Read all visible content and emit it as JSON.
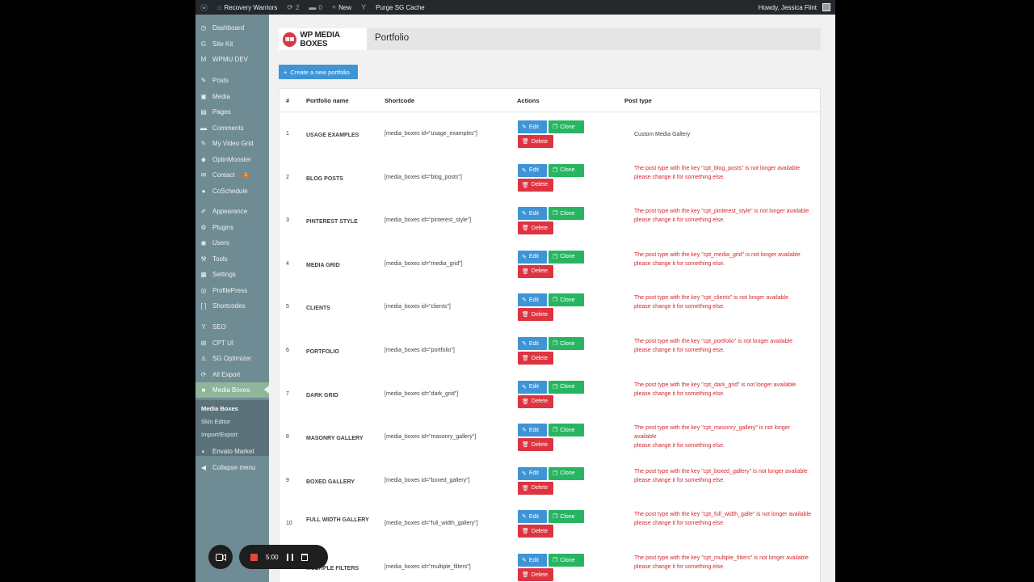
{
  "admin_bar": {
    "site_name": "Recovery Warriors",
    "updates_count": "2",
    "comments_count": "0",
    "new_label": "New",
    "purge_label": "Purge SG Cache",
    "howdy": "Howdy, Jessica Flint"
  },
  "sidebar": {
    "items": [
      {
        "label": "Dashboard",
        "icon": "dashboard-icon",
        "glyph": "◷"
      },
      {
        "label": "Site Kit",
        "icon": "sitekit-icon",
        "glyph": "G"
      },
      {
        "label": "WPMU DEV",
        "icon": "wpmudev-icon",
        "glyph": "M"
      },
      {
        "label": "Posts",
        "icon": "pin-icon",
        "glyph": "✎"
      },
      {
        "label": "Media",
        "icon": "media-icon",
        "glyph": "▣"
      },
      {
        "label": "Pages",
        "icon": "pages-icon",
        "glyph": "▤"
      },
      {
        "label": "Comments",
        "icon": "comments-icon",
        "glyph": "▬"
      },
      {
        "label": "My Video Grid",
        "icon": "pin-icon",
        "glyph": "✎"
      },
      {
        "label": "OptinMonster",
        "icon": "optinmonster-icon",
        "glyph": "☻"
      },
      {
        "label": "Contact",
        "icon": "mail-icon",
        "glyph": "✉",
        "badge": "1"
      },
      {
        "label": "CoSchedule",
        "icon": "coschedule-icon",
        "glyph": "●"
      },
      {
        "label": "Appearance",
        "icon": "brush-icon",
        "glyph": "✐"
      },
      {
        "label": "Plugins",
        "icon": "plugin-icon",
        "glyph": "⚙"
      },
      {
        "label": "Users",
        "icon": "users-icon",
        "glyph": "◉"
      },
      {
        "label": "Tools",
        "icon": "wrench-icon",
        "glyph": "⚒"
      },
      {
        "label": "Settings",
        "icon": "settings-icon",
        "glyph": "▦"
      },
      {
        "label": "ProfilePress",
        "icon": "profilepress-icon",
        "glyph": "◎"
      },
      {
        "label": "Shortcodes",
        "icon": "shortcodes-icon",
        "glyph": "[ ]"
      },
      {
        "label": "SEO",
        "icon": "yoast-icon",
        "glyph": "Y"
      },
      {
        "label": "CPT UI",
        "icon": "cptui-icon",
        "glyph": "⊞"
      },
      {
        "label": "SG Optimizer",
        "icon": "sgoptimizer-icon",
        "glyph": "♙"
      },
      {
        "label": "All Export",
        "icon": "export-icon",
        "glyph": "⟳"
      },
      {
        "label": "Media Boxes",
        "icon": "mediaboxes-icon",
        "glyph": "■"
      },
      {
        "label": "Envato Market",
        "icon": "envato-icon",
        "glyph": "◐"
      },
      {
        "label": "Collapse menu",
        "icon": "collapse-icon",
        "glyph": "◀"
      }
    ],
    "submenu": [
      "Media Boxes",
      "Skin Editor",
      "Import/Export"
    ]
  },
  "header": {
    "logo_text": "WP MEDIA BOXES",
    "title": "Portfolio"
  },
  "create_button": "Create a new portfolio",
  "table": {
    "columns": [
      "#",
      "Portfolio name",
      "Shortcode",
      "Actions",
      "Post type"
    ],
    "edit_label": "Edit",
    "clone_label": "Clone",
    "delete_label": "Delete",
    "rows": [
      {
        "num": "1",
        "name": "USAGE EXAMPLES",
        "shortcode": "[media_boxes id=\"usage_examples\"]",
        "post_type": "Custom Media Gallery",
        "error": false
      },
      {
        "num": "2",
        "name": "BLOG POSTS",
        "shortcode": "[media_boxes id=\"blog_posts\"]",
        "post_type": "The post type with the key \"cpt_blog_posts\" is not longer available",
        "post_type_2": "please change it for something else.",
        "error": true
      },
      {
        "num": "3",
        "name": "PINTEREST STYLE",
        "shortcode": "[media_boxes id=\"pinterest_style\"]",
        "post_type": "The post type with the key \"cpt_pinterest_style\" is not longer available",
        "post_type_2": "please change it for something else.",
        "error": true
      },
      {
        "num": "4",
        "name": "MEDIA GRID",
        "shortcode": "[media_boxes id=\"media_grid\"]",
        "post_type": "The post type with the key \"cpt_media_grid\" is not longer available",
        "post_type_2": "please change it for something else.",
        "error": true
      },
      {
        "num": "5",
        "name": "CLIENTS",
        "shortcode": "[media_boxes id=\"clients\"]",
        "post_type": "The post type with the key \"cpt_clients\" is not longer available",
        "post_type_2": "please change it for something else.",
        "error": true
      },
      {
        "num": "6",
        "name": "PORTFOLIO",
        "shortcode": "[media_boxes id=\"portfolio\"]",
        "post_type": "The post type with the key \"cpt_portfolio\" is not longer available",
        "post_type_2": "please change it for something else.",
        "error": true
      },
      {
        "num": "7",
        "name": "DARK GRID",
        "shortcode": "[media_boxes id=\"dark_grid\"]",
        "post_type": "The post type with the key \"cpt_dark_grid\" is not longer available",
        "post_type_2": "please change it for something else.",
        "error": true
      },
      {
        "num": "8",
        "name": "MASONRY GALLERY",
        "shortcode": "[media_boxes id=\"masonry_gallery\"]",
        "post_type": "The post type with the key \"cpt_masonry_gallery\" is not longer available",
        "post_type_2": "please change it for something else.",
        "error": true
      },
      {
        "num": "9",
        "name": "BOXED GALLERY",
        "shortcode": "[media_boxes id=\"boxed_gallery\"]",
        "post_type": "The post type with the key \"cpt_boxed_gallery\" is not longer available",
        "post_type_2": "please change it for something else.",
        "error": true
      },
      {
        "num": "10",
        "name": "FULL WIDTH GALLERY",
        "shortcode": "[media_boxes id=\"full_width_gallery\"]",
        "post_type": "The post type with the key \"cpt_full_width_galle\" is not longer available",
        "post_type_2": "please change it for something else.",
        "error": true
      },
      {
        "num": "11",
        "name": "MULTIPLE FILTERS",
        "shortcode": "[media_boxes id=\"multiple_filters\"]",
        "post_type": "The post type with the key \"cpt_multiple_filters\" is not longer available",
        "post_type_2": "please change it for something else.",
        "error": true
      }
    ]
  },
  "recorder": {
    "time": "5:00"
  },
  "colors": {
    "sidebar": "#6f8c95",
    "active_menu": "#8fb59a",
    "edit": "#3f94d6",
    "clone": "#27b561",
    "delete": "#dc3541",
    "error_text": "#d4262c"
  }
}
